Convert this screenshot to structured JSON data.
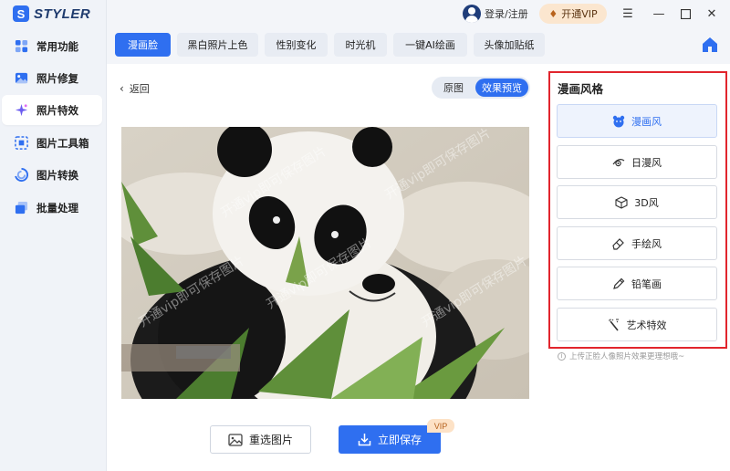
{
  "app": {
    "logo_letter": "S",
    "logo_text": "STYLER"
  },
  "sidebar": {
    "items": [
      {
        "label": "常用功能",
        "icon": "grid-icon",
        "active": false
      },
      {
        "label": "照片修复",
        "icon": "photo-repair-icon",
        "active": false
      },
      {
        "label": "照片特效",
        "icon": "sparkle-icon",
        "active": true
      },
      {
        "label": "图片工具箱",
        "icon": "toolbox-icon",
        "active": false
      },
      {
        "label": "图片转换",
        "icon": "convert-icon",
        "active": false
      },
      {
        "label": "批量处理",
        "icon": "batch-icon",
        "active": false
      }
    ]
  },
  "header": {
    "login_label": "登录/注册",
    "vip_label": "开通VIP"
  },
  "tabs": [
    {
      "label": "漫画脸",
      "active": true
    },
    {
      "label": "黑白照片上色",
      "active": false
    },
    {
      "label": "性别变化",
      "active": false
    },
    {
      "label": "时光机",
      "active": false
    },
    {
      "label": "一键AI绘画",
      "active": false
    },
    {
      "label": "头像加贴纸",
      "active": false
    }
  ],
  "main": {
    "back_label": "返回",
    "toggle": {
      "original": "原图",
      "preview": "效果预览"
    },
    "watermark": "开通vip即可保存图片",
    "reselect_label": "重选图片",
    "save_label": "立即保存",
    "save_badge": "VIP"
  },
  "style_panel": {
    "title": "漫画风格",
    "options": [
      {
        "label": "漫画风",
        "icon": "bear-icon",
        "active": true
      },
      {
        "label": "日漫风",
        "icon": "anime-eye-icon",
        "active": false
      },
      {
        "label": "3D风",
        "icon": "cube-icon",
        "active": false
      },
      {
        "label": "手绘风",
        "icon": "eraser-icon",
        "active": false
      },
      {
        "label": "铅笔画",
        "icon": "pencil-icon",
        "active": false
      },
      {
        "label": "艺术特效",
        "icon": "magic-wand-icon",
        "active": false
      }
    ],
    "tip": "上传正脸人像照片效果更理想哦~"
  },
  "colors": {
    "accent": "#2f6ff0",
    "highlight_border": "#e1252d",
    "vip": "#fbe6cf"
  }
}
